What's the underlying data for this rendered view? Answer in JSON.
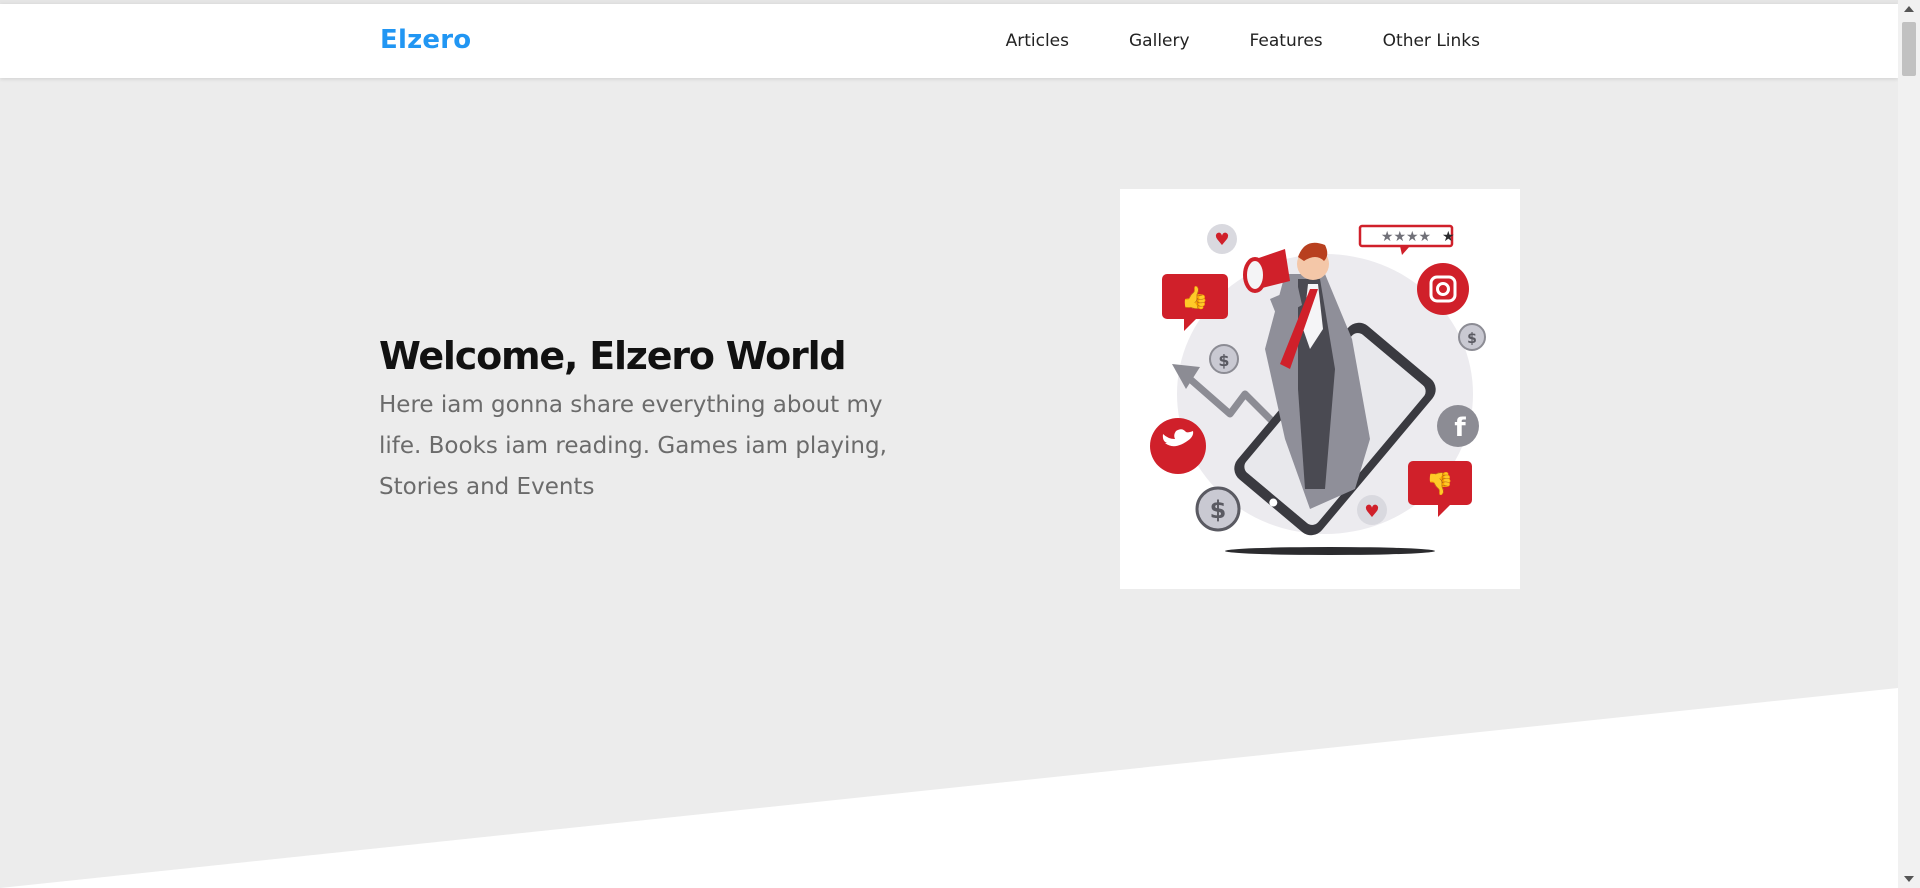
{
  "header": {
    "logo": "Elzero",
    "nav": [
      {
        "label": "Articles"
      },
      {
        "label": "Gallery"
      },
      {
        "label": "Features"
      },
      {
        "label": "Other Links"
      }
    ]
  },
  "hero": {
    "title": "Welcome, Elzero World",
    "description": "Here iam gonna share everything about my life. Books iam reading. Games iam playing, Stories and Events",
    "image_icon": "social-media-marketing-illustration-icon",
    "scroll_icon": "double-chevron-down-icon"
  },
  "colors": {
    "brand": "#2196f3",
    "hero_background": "#ececec",
    "illustration_red": "#d0202a"
  }
}
